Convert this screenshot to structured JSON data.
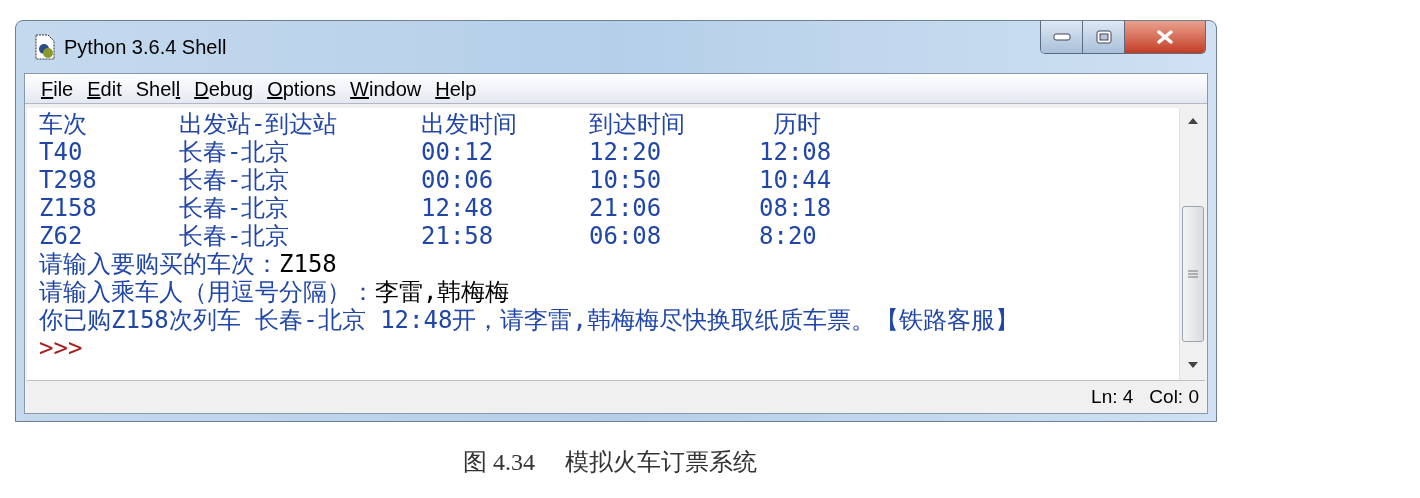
{
  "window": {
    "title": "Python 3.6.4 Shell"
  },
  "menu": [
    {
      "key": "F",
      "post": "ile"
    },
    {
      "key": "E",
      "post": "dit"
    },
    {
      "pre": "Shel",
      "key": "l"
    },
    {
      "key": "D",
      "post": "ebug"
    },
    {
      "key": "O",
      "post": "ptions"
    },
    {
      "key": "W",
      "post": "indow"
    },
    {
      "key": "H",
      "post": "elp"
    }
  ],
  "table": {
    "columns": [
      "车次",
      "出发站-到达站",
      "出发时间",
      "到达时间",
      "历时"
    ],
    "rows": [
      [
        "T40",
        "长春-北京",
        "00:12",
        "12:20",
        "12:08"
      ],
      [
        "T298",
        "长春-北京",
        "00:06",
        "10:50",
        "10:44"
      ],
      [
        "Z158",
        "长春-北京",
        "12:48",
        "21:06",
        "08:18"
      ],
      [
        "Z62",
        "长春-北京",
        "21:58",
        "06:08",
        "8:20"
      ]
    ]
  },
  "lines": [
    {
      "output": "请输入要购买的车次：",
      "input": "Z158"
    },
    {
      "output": "请输入乘车人（用逗号分隔）：",
      "input": "李雷,韩梅梅"
    },
    {
      "output": "你已购Z158次列车 长春-北京 12:48开，请李雷,韩梅梅尽快换取纸质车票。【铁路客服】"
    }
  ],
  "prompt": ">>>",
  "status_bar": {
    "line": "Ln: 4",
    "col": "Col: 0"
  },
  "caption": {
    "number": "图 4.34",
    "text": "模拟火车订票系统"
  }
}
